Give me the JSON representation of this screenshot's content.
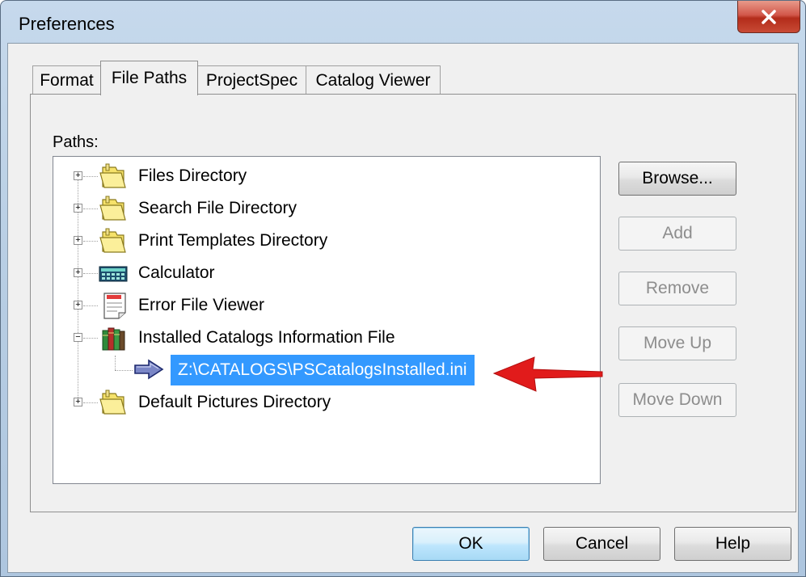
{
  "window": {
    "title": "Preferences",
    "close_glyph": "X",
    "accent": "#c9402c"
  },
  "tabs": [
    {
      "label": "Format",
      "active": false
    },
    {
      "label": "File Paths",
      "active": true
    },
    {
      "label": "ProjectSpec",
      "active": false
    },
    {
      "label": "Catalog Viewer",
      "active": false
    }
  ],
  "paths": {
    "label": "Paths:",
    "items": [
      {
        "label": "Files Directory",
        "icon": "folder-icon",
        "expander": "+"
      },
      {
        "label": "Search File Directory",
        "icon": "folder-icon",
        "expander": "+"
      },
      {
        "label": "Print Templates Directory",
        "icon": "folder-icon",
        "expander": "+"
      },
      {
        "label": "Calculator",
        "icon": "calculator-icon",
        "expander": "+"
      },
      {
        "label": "Error File Viewer",
        "icon": "note-icon",
        "expander": "+"
      },
      {
        "label": "Installed Catalogs Information File",
        "icon": "books-icon",
        "expander": "−"
      },
      {
        "label": "Default Pictures Directory",
        "icon": "folder-icon",
        "expander": "+"
      }
    ],
    "selected_child": {
      "label": "Z:\\CATALOGS\\PSCatalogsInstalled.ini",
      "icon": "arrow-right-icon",
      "highlight": "#3399ff"
    },
    "annotation_arrow_color": "#e11b1b"
  },
  "side_buttons": {
    "browse": "Browse...",
    "add": "Add",
    "remove": "Remove",
    "move_up": "Move Up",
    "move_down": "Move Down"
  },
  "footer": {
    "ok": "OK",
    "cancel": "Cancel",
    "help": "Help"
  }
}
